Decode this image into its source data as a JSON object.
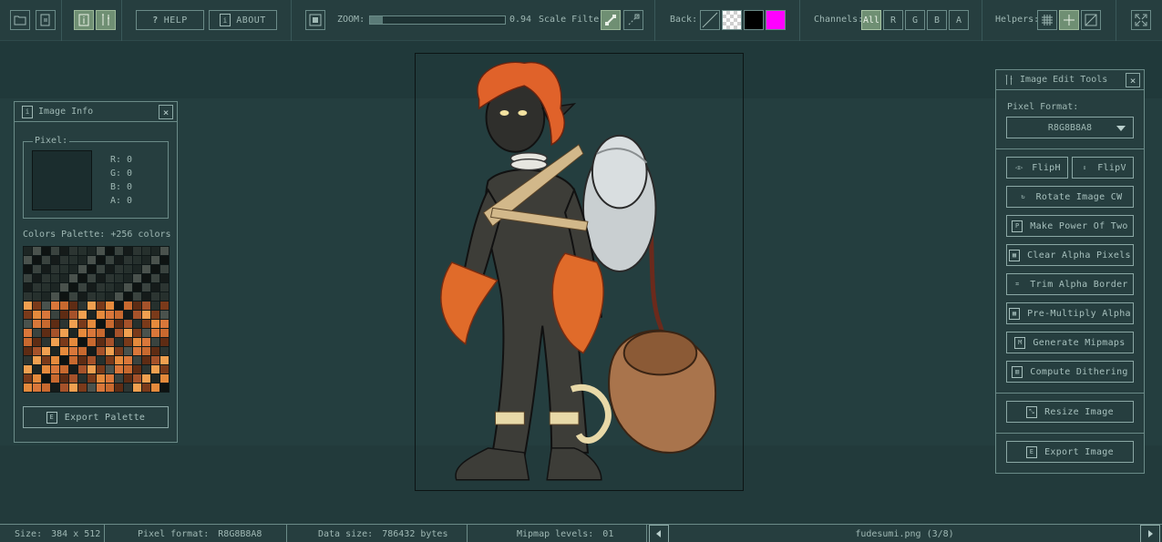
{
  "toolbar": {
    "help_label": "HELP",
    "about_label": "ABOUT",
    "zoom_label": "ZOOM:",
    "zoom_value": "0.94",
    "zoom_fraction": 0.094,
    "scale_filter_label": "Scale Filter:",
    "back_label": "Back:",
    "back_colors": [
      "#1e3334",
      "checker",
      "#000000",
      "#ff00ff"
    ],
    "channels_label": "Channels:",
    "channels": [
      "All",
      "R",
      "G",
      "B",
      "A"
    ],
    "helpers_label": "Helpers:"
  },
  "info_panel": {
    "title": "Image Info",
    "pixel_label": "Pixel:",
    "r": "R: 0",
    "g": "G: 0",
    "b": "B: 0",
    "a": "A: 0",
    "palette_label": "Colors Palette: +256 colors",
    "export_palette": "Export Palette"
  },
  "tools_panel": {
    "title": "Image Edit Tools",
    "pixel_format_label": "Pixel Format:",
    "pixel_format_value": "R8G8B8A8",
    "flip_h": "FlipH",
    "flip_v": "FlipV",
    "rotate": "Rotate Image CW",
    "pot": "Make Power Of Two",
    "clear_alpha": "Clear Alpha Pixels",
    "trim_alpha": "Trim Alpha Border",
    "premultiply": "Pre-Multiply Alpha",
    "mipmaps": "Generate Mipmaps",
    "dithering": "Compute Dithering",
    "resize": "Resize Image",
    "export": "Export Image"
  },
  "status": {
    "size_label": "Size:",
    "size_value": "384 x 512",
    "format_label": "Pixel format:",
    "format_value": "R8G8B8A8",
    "datasize_label": "Data size:",
    "datasize_value": "786432 bytes",
    "mipmap_label": "Mipmap levels:",
    "mipmap_value": "01",
    "filename": "fudesumi.png (3/8)"
  },
  "colors": {
    "accent": "#6f8f73",
    "panel_bg": "#263e3f",
    "border": "#6b8b88",
    "magenta": "#ff00ff"
  }
}
